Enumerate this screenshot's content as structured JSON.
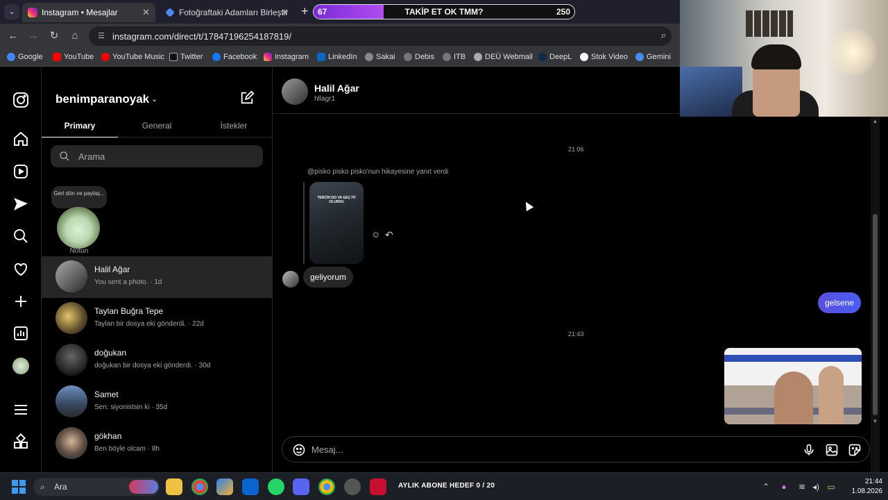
{
  "browser": {
    "tabs": [
      {
        "title": "Instagram • Mesajlar",
        "active": true
      },
      {
        "title": "Fotoğraftaki Adamları Birleştir",
        "active": false
      }
    ],
    "url": "instagram.com/direct/t/17847196254187819/",
    "bookmarks": [
      "Google",
      "YouTube",
      "YouTube Music",
      "Twitter",
      "Facebook",
      "Instagram",
      "LinkedIn",
      "Sakai",
      "Debis",
      "ITB",
      "DEÜ Webmail",
      "DeepL",
      "Stok Video",
      "Gemini"
    ]
  },
  "overlay": {
    "current": "67",
    "label": "TAKİP ET OK TMM?",
    "target": "250",
    "progress_fraction": 0.268
  },
  "inbox": {
    "account": "benimparanoyak",
    "tabs": [
      "Primary",
      "General",
      "İstekler"
    ],
    "search_placeholder": "Arama",
    "note_bubble": "Geri dön ve paylaş...",
    "note_label": "Notun",
    "conversations": [
      {
        "name": "Halil Ağar",
        "sub": "You sent a photo. · 1d"
      },
      {
        "name": "Taylan Buğra Tepe",
        "sub": "Taylan bir dosya eki gönderdi. · 22d"
      },
      {
        "name": "doğukan",
        "sub": "doğukan bir dosya eki gönderdi. · 30d"
      },
      {
        "name": "Samet",
        "sub": "Sen: siyonistsin ki · 35d"
      },
      {
        "name": "gökhan",
        "sub": "Ben böyle olcam · 8h"
      }
    ]
  },
  "chat": {
    "name": "Halil Ağar",
    "username": "hllagr1",
    "timestamp1": "21:06",
    "reply_note": "@pisko pisko pisko'nun hikayesine yanıt verdi",
    "story_caption": "TERCİH DO VA GEÇ İYİ OLURDU",
    "incoming": "geliyorum",
    "outgoing": "gelsene",
    "timestamp2": "21:43",
    "composer_placeholder": "Mesaj..."
  },
  "taskbar": {
    "search": "Ara",
    "goal": "AYLIK ABONE HEDEF 0 / 20",
    "time": "21:44",
    "date": "1.08.2026"
  },
  "colors": {
    "outgoing_bubble": "#4a5cf2",
    "overlay_fill": "#9b3fe6"
  }
}
